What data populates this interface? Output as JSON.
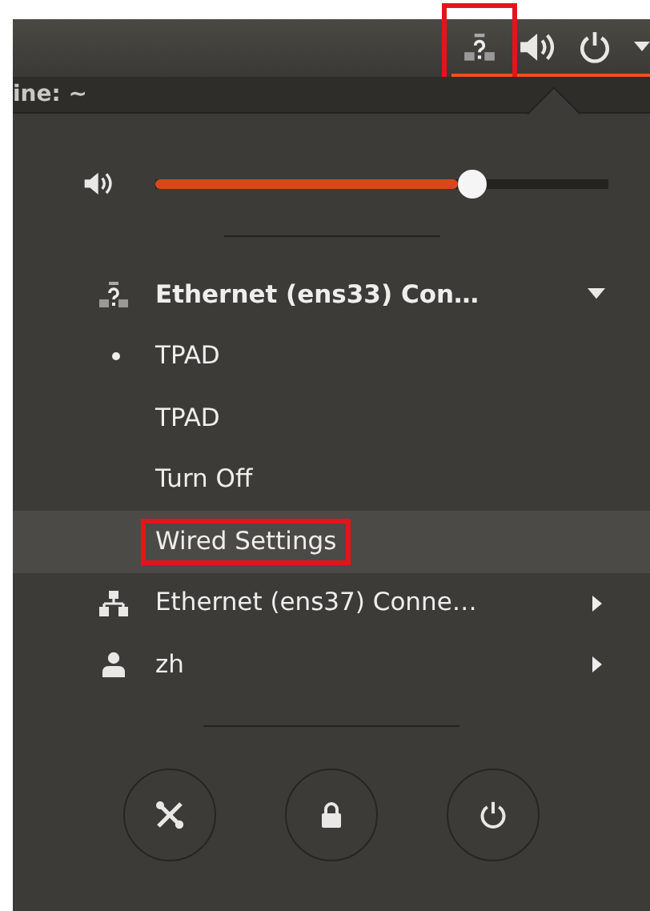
{
  "top_bar": {
    "indicators": [
      {
        "kind": "network-unknown",
        "annotated": true,
        "active": true
      },
      {
        "kind": "volume",
        "annotated": false,
        "active": true
      },
      {
        "kind": "power",
        "annotated": false,
        "active": true
      },
      {
        "kind": "caret",
        "annotated": false,
        "active": true
      }
    ]
  },
  "background_window": {
    "title": "ine: ~"
  },
  "volume": {
    "level": 0.7
  },
  "menu_items": [
    {
      "kind": "device",
      "label": "Ethernet (ens33) Con…",
      "expanded": true
    },
    {
      "kind": "option",
      "label": "TPAD",
      "selected": true
    },
    {
      "kind": "option",
      "label": "TPAD",
      "selected": false
    },
    {
      "kind": "action",
      "label": "Turn Off",
      "highlighted": false,
      "annotated": false
    },
    {
      "kind": "action",
      "label": "Wired Settings",
      "highlighted": true,
      "annotated": true
    },
    {
      "kind": "network",
      "label": "Ethernet (ens37) Conne…",
      "expanded": false
    },
    {
      "kind": "account",
      "label": "zh",
      "expanded": false
    }
  ],
  "system_buttons": [
    {
      "kind": "settings"
    },
    {
      "kind": "lock"
    },
    {
      "kind": "power"
    }
  ]
}
